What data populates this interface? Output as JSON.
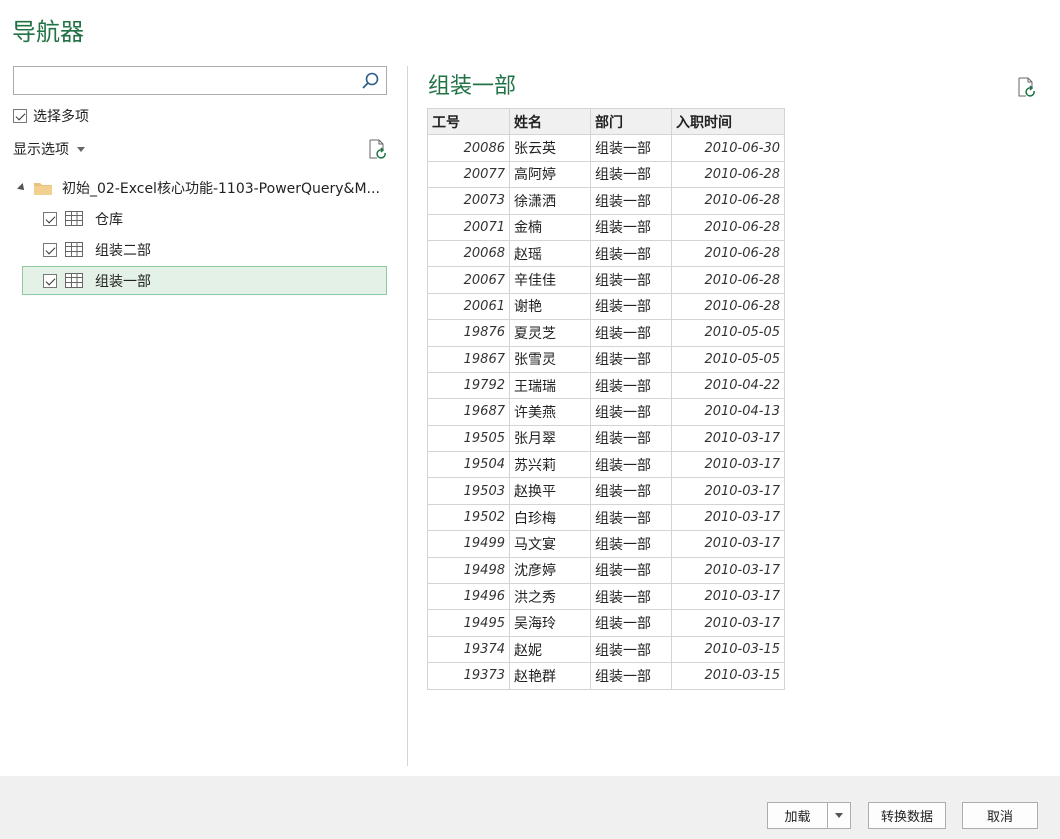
{
  "window": {
    "title": "导航器"
  },
  "search": {
    "value": "",
    "placeholder": ""
  },
  "select_multiple": {
    "label": "选择多项",
    "checked": true
  },
  "display_options": {
    "label": "显示选项"
  },
  "tree": {
    "folder": {
      "label": "初始_02-Excel核心功能-1103-PowerQuery&M..."
    },
    "items": [
      {
        "label": "仓库",
        "checked": true,
        "selected": false
      },
      {
        "label": "组装二部",
        "checked": true,
        "selected": false
      },
      {
        "label": "组装一部",
        "checked": true,
        "selected": true
      }
    ]
  },
  "preview": {
    "title": "组装一部",
    "columns": [
      "工号",
      "姓名",
      "部门",
      "入职时间"
    ],
    "rows": [
      [
        "20086",
        "张云英",
        "组装一部",
        "2010-06-30"
      ],
      [
        "20077",
        "高阿婷",
        "组装一部",
        "2010-06-28"
      ],
      [
        "20073",
        "徐潇洒",
        "组装一部",
        "2010-06-28"
      ],
      [
        "20071",
        "金楠",
        "组装一部",
        "2010-06-28"
      ],
      [
        "20068",
        "赵瑶",
        "组装一部",
        "2010-06-28"
      ],
      [
        "20067",
        "辛佳佳",
        "组装一部",
        "2010-06-28"
      ],
      [
        "20061",
        "谢艳",
        "组装一部",
        "2010-06-28"
      ],
      [
        "19876",
        "夏灵芝",
        "组装一部",
        "2010-05-05"
      ],
      [
        "19867",
        "张雪灵",
        "组装一部",
        "2010-05-05"
      ],
      [
        "19792",
        "王瑞瑞",
        "组装一部",
        "2010-04-22"
      ],
      [
        "19687",
        "许美燕",
        "组装一部",
        "2010-04-13"
      ],
      [
        "19505",
        "张月翠",
        "组装一部",
        "2010-03-17"
      ],
      [
        "19504",
        "苏兴莉",
        "组装一部",
        "2010-03-17"
      ],
      [
        "19503",
        "赵换平",
        "组装一部",
        "2010-03-17"
      ],
      [
        "19502",
        "白珍梅",
        "组装一部",
        "2010-03-17"
      ],
      [
        "19499",
        "马文宴",
        "组装一部",
        "2010-03-17"
      ],
      [
        "19498",
        "沈彦婷",
        "组装一部",
        "2010-03-17"
      ],
      [
        "19496",
        "洪之秀",
        "组装一部",
        "2010-03-17"
      ],
      [
        "19495",
        "吴海玲",
        "组装一部",
        "2010-03-17"
      ],
      [
        "19374",
        "赵妮",
        "组装一部",
        "2010-03-15"
      ],
      [
        "19373",
        "赵艳群",
        "组装一部",
        "2010-03-15"
      ]
    ]
  },
  "buttons": {
    "load": "加载",
    "transform": "转换数据",
    "cancel": "取消"
  },
  "colors": {
    "accent": "#217346",
    "selected_bg": "#e3f1e7",
    "selected_border": "#8fc8a1"
  },
  "icons": {
    "search": "search-icon",
    "refresh": "refresh-icon",
    "folder": "folder-icon",
    "table": "table-icon",
    "dropdown": "chevron-down-icon"
  }
}
